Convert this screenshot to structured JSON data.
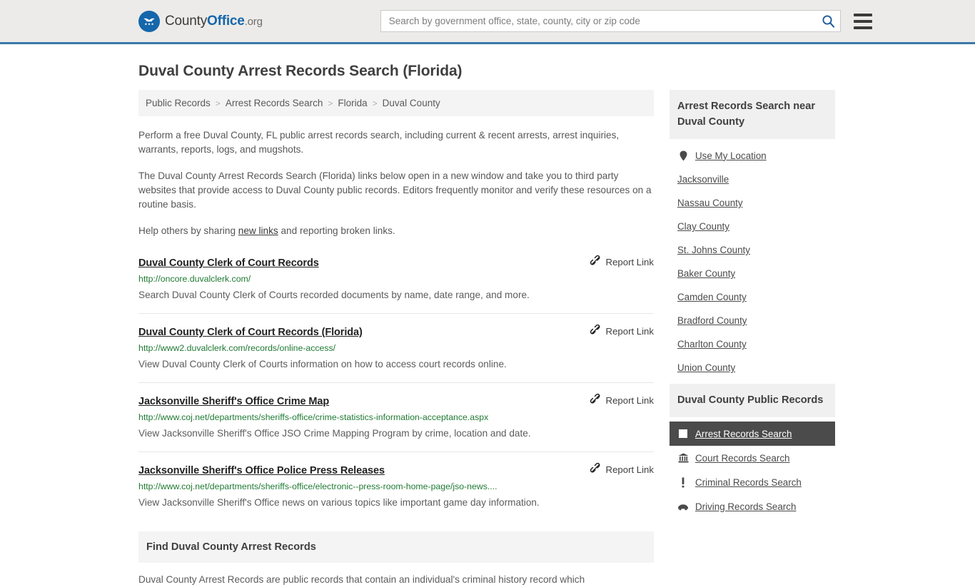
{
  "header": {
    "brand": {
      "part1": "County",
      "part2": "Office",
      "part3": ".org",
      "icon": "eagle-seal-icon"
    },
    "search": {
      "placeholder": "Search by government office, state, county, city or zip code",
      "value": "",
      "button_icon": "search-icon"
    },
    "menu_icon": "hamburger-menu-icon",
    "accent_color": "#3b77ab"
  },
  "page": {
    "title": "Duval County Arrest Records Search (Florida)"
  },
  "breadcrumb": {
    "separator": ">",
    "items": [
      {
        "label": "Public Records"
      },
      {
        "label": "Arrest Records Search"
      },
      {
        "label": "Florida"
      },
      {
        "label": "Duval County"
      }
    ]
  },
  "intro": {
    "p1": "Perform a free Duval County, FL public arrest records search, including current & recent arrests, arrest inquiries, warrants, reports, logs, and mugshots.",
    "p2": "The Duval County Arrest Records Search (Florida) links below open in a new window and take you to third party websites that provide access to Duval County public records. Editors frequently monitor and verify these resources on a routine basis.",
    "p3_before": "Help others by sharing ",
    "p3_link": "new links",
    "p3_after": " and reporting broken links."
  },
  "results": {
    "report_label": "Report Link",
    "report_icon": "broken-link-icon",
    "items": [
      {
        "title": "Duval County Clerk of Court Records",
        "url": "http://oncore.duvalclerk.com/",
        "desc": "Search Duval County Clerk of Courts recorded documents by name, date range, and more."
      },
      {
        "title": "Duval County Clerk of Court Records (Florida)",
        "url": "http://www2.duvalclerk.com/records/online-access/",
        "desc": "View Duval County Clerk of Courts information on how to access court records online."
      },
      {
        "title": "Jacksonville Sheriff's Office Crime Map",
        "url": "http://www.coj.net/departments/sheriffs-office/crime-statistics-information-acceptance.aspx",
        "desc": "View Jacksonville Sheriff's Office JSO Crime Mapping Program by crime, location and date."
      },
      {
        "title": "Jacksonville Sheriff's Office Police Press Releases",
        "url": "http://www.coj.net/departments/sheriffs-office/electronic--press-room-home-page/jso-news....",
        "desc": "View Jacksonville Sheriff's Office news on various topics like important game day information."
      }
    ]
  },
  "find_section": {
    "heading": "Find Duval County Arrest Records",
    "body": "Duval County Arrest Records are public records that contain an individual's criminal history record which"
  },
  "sidebar": {
    "nearby": {
      "title": "Arrest Records Search near Duval County",
      "items": [
        {
          "label": "Use My Location",
          "icon": "map-pin-icon"
        },
        {
          "label": "Jacksonville",
          "icon": ""
        },
        {
          "label": "Nassau County",
          "icon": ""
        },
        {
          "label": "Clay County",
          "icon": ""
        },
        {
          "label": "St. Johns County",
          "icon": ""
        },
        {
          "label": "Baker County",
          "icon": ""
        },
        {
          "label": "Camden County",
          "icon": ""
        },
        {
          "label": "Bradford County",
          "icon": ""
        },
        {
          "label": "Charlton County",
          "icon": ""
        },
        {
          "label": "Union County",
          "icon": ""
        }
      ]
    },
    "public_records": {
      "title": "Duval County Public Records",
      "items": [
        {
          "label": "Arrest Records Search",
          "icon": "fingerprint-card-icon",
          "active": true
        },
        {
          "label": "Court Records Search",
          "icon": "courthouse-icon",
          "active": false
        },
        {
          "label": "Criminal Records Search",
          "icon": "exclamation-icon",
          "active": false
        },
        {
          "label": "Driving Records Search",
          "icon": "car-icon",
          "active": false
        }
      ]
    }
  }
}
